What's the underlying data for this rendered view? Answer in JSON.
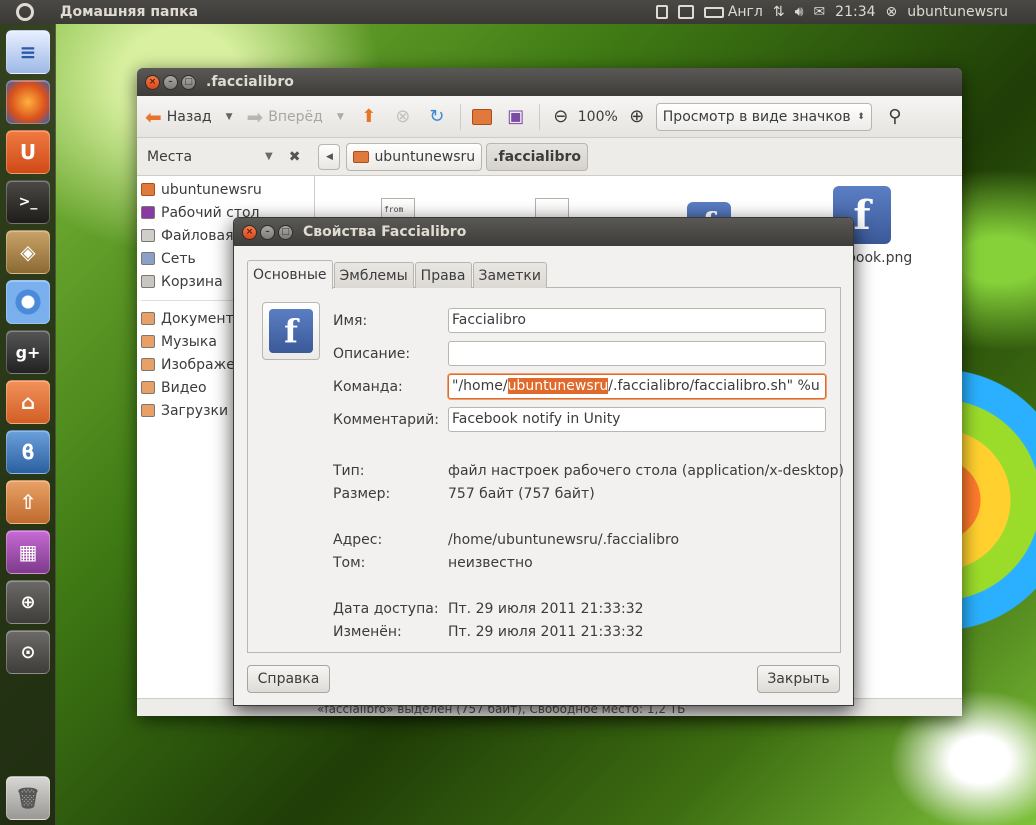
{
  "top_panel": {
    "app_title": "Домашняя папка",
    "keyboard_layout": "Англ",
    "clock": "21:34",
    "user": "ubuntunewsru"
  },
  "launcher": {
    "items": [
      "document-icon",
      "firefox-icon",
      "ubuntu-one-icon",
      "terminal-icon",
      "software-center-icon",
      "chromium-icon",
      "google-plus-icon",
      "home-folder-icon",
      "bluetooth-icon",
      "update-icon",
      "workspaces-icon",
      "zoom-in-icon",
      "zoom-search-icon",
      "trash-icon"
    ]
  },
  "fm": {
    "title": ".faccialibro",
    "toolbar": {
      "back": "Назад",
      "forward": "Вперёд",
      "zoom": "100%",
      "view_mode": "Просмотр в виде значков"
    },
    "places_label": "Места",
    "breadcrumbs": [
      "ubuntunewsru",
      ".faccialibro"
    ],
    "sidebar": [
      "ubuntunewsru",
      "Рабочий стол",
      "Файловая",
      "Сеть",
      "Корзина",
      "Документы",
      "Музыка",
      "Изображе",
      "Видео",
      "Загрузки"
    ],
    "files": {
      "fb_name": "book.png",
      "script_label": "from"
    },
    "status": "«faccialibro» выделен (757 байт), Свободное место: 1,2 ТБ"
  },
  "dialog": {
    "title": "Свойства Faccialibro",
    "tabs": [
      "Основные",
      "Эмблемы",
      "Права",
      "Заметки"
    ],
    "labels": {
      "name": "Имя:",
      "description": "Описание:",
      "command": "Команда:",
      "comment": "Комментарий:",
      "type": "Тип:",
      "size": "Размер:",
      "address": "Адрес:",
      "volume": "Том:",
      "accessed": "Дата доступа:",
      "modified": "Изменён:"
    },
    "fields": {
      "name": "Faccialibro",
      "description": "",
      "command_pre": "\"/home/",
      "command_sel": "ubuntunewsru",
      "command_post": "/.faccialibro/faccialibro.sh\" %u",
      "comment": "Facebook notify in Unity"
    },
    "values": {
      "type": "файл настроек рабочего стола (application/x-desktop)",
      "size": "757 байт (757 байт)",
      "address": "/home/ubuntunewsru/.faccialibro",
      "volume": "неизвестно",
      "accessed": "Пт. 29 июля 2011 21:33:32",
      "modified": "Пт. 29 июля 2011 21:33:32"
    },
    "buttons": {
      "help": "Справка",
      "close": "Закрыть"
    }
  },
  "colors": {
    "accent": "#e06a2c",
    "panel": "#3c3b37",
    "facebook": "#3b5998"
  }
}
